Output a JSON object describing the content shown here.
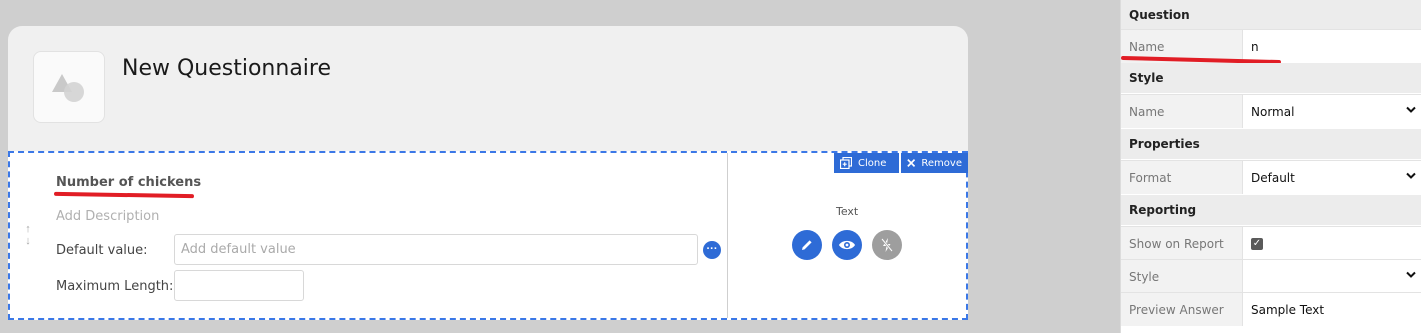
{
  "header": {
    "title": "New Questionnaire",
    "logo_icon": "shapes-placeholder-icon"
  },
  "question": {
    "title": "Number of chickens",
    "description_placeholder": "Add Description",
    "default_value_label": "Default value:",
    "default_value_placeholder": "Add default value",
    "default_value": "",
    "max_length_label": "Maximum Length:",
    "max_length_value": "",
    "more_icon": "ellipsis-icon",
    "drag_icon": "drag-arrows-icon"
  },
  "actions": {
    "clone_label": "Clone",
    "remove_label": "Remove",
    "clone_icon": "clone-icon",
    "remove_icon": "close-icon"
  },
  "type_panel": {
    "type_label": "Text",
    "edit_icon": "pencil-icon",
    "visibility_icon": "eye-icon",
    "disabled_icon": "lightning-off-icon"
  },
  "properties": {
    "question_header": "Question",
    "name_label": "Name",
    "name_value": "n",
    "style_header": "Style",
    "style_name_label": "Name",
    "style_name_value": "Normal",
    "properties_header": "Properties",
    "format_label": "Format",
    "format_value": "Default",
    "reporting_header": "Reporting",
    "show_on_report_label": "Show on Report",
    "show_on_report_checked": true,
    "report_style_label": "Style",
    "report_style_value": "",
    "preview_answer_label": "Preview Answer",
    "preview_answer_value": "Sample Text"
  },
  "colors": {
    "accent_blue": "#2e6bd6",
    "highlight_red": "#e11d25",
    "disabled_gray": "#9e9e9e"
  }
}
